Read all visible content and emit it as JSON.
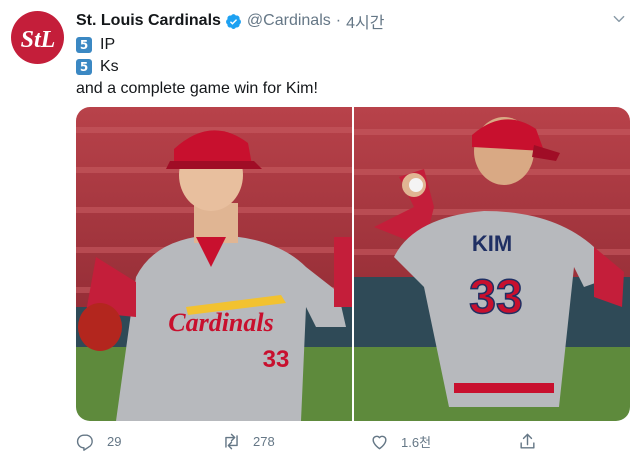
{
  "tweet": {
    "display_name": "St. Louis Cardinals",
    "handle": "@Cardinals",
    "separator": "·",
    "time": "4시간",
    "lines": [
      {
        "emoji": "5",
        "text": "IP"
      },
      {
        "emoji": "5",
        "text": "Ks"
      }
    ],
    "sentence": "and a complete game win for Kim!",
    "photo_left": {
      "lettering": "Cardinals",
      "number": "33"
    },
    "photo_right": {
      "name": "KIM",
      "number": "33"
    }
  },
  "actions": {
    "reply_count": "29",
    "retweet_count": "278",
    "like_count": "1.6천"
  },
  "icons": [
    "cardinals-logo-icon",
    "verified-badge-icon",
    "chevron-down-icon",
    "reply-icon",
    "retweet-icon",
    "like-icon",
    "share-icon"
  ],
  "colors": {
    "brand": "#c41e3a",
    "verified": "#1da1f2",
    "muted": "#657786",
    "emoji_blue": "#3b88c3"
  }
}
